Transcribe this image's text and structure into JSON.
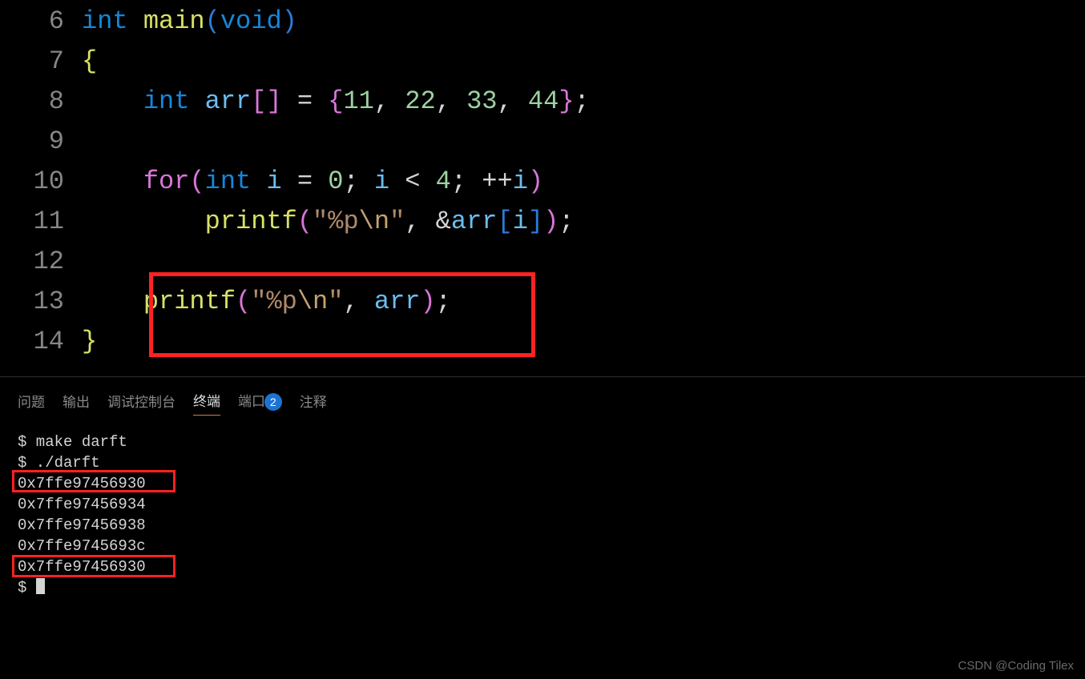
{
  "code": {
    "line6": {
      "n": "6",
      "kw1": "int",
      "fn": "main",
      "lp": "(",
      "kw2": "void",
      "rp": ")"
    },
    "line7": {
      "n": "7",
      "br": "{"
    },
    "line8": {
      "n": "8",
      "kw": "int",
      "var": "arr",
      "lb": "[",
      "rb": "]",
      "eq": " = ",
      "lbr": "{",
      "v1": "11",
      "c1": ", ",
      "v2": "22",
      "c2": ", ",
      "v3": "33",
      "c3": ", ",
      "v4": "44",
      "rbr": "}",
      "semi": ";"
    },
    "line9": {
      "n": "9"
    },
    "line10": {
      "n": "10",
      "kw": "for",
      "lp": "(",
      "kw2": "int",
      "var": "i",
      "eq": " = ",
      "v0": "0",
      "semi1": "; ",
      "var2": "i",
      "lt": " < ",
      "v4": "4",
      "semi2": "; ",
      "inc": "++",
      "var3": "i",
      "rp": ")"
    },
    "line11": {
      "n": "11",
      "fn": "printf",
      "lp": "(",
      "q1": "\"",
      "fmt": "%p",
      "esc": "\\n",
      "q2": "\"",
      "c": ", ",
      "amp": "&",
      "var": "arr",
      "lb": "[",
      "idx": "i",
      "rb": "]",
      "rp": ")",
      "semi": ";"
    },
    "line12": {
      "n": "12"
    },
    "line13": {
      "n": "13",
      "fn": "printf",
      "lp": "(",
      "q1": "\"",
      "fmt": "%p",
      "esc": "\\n",
      "q2": "\"",
      "c": ", ",
      "var": "arr",
      "rp": ")",
      "semi": ";"
    },
    "line14": {
      "n": "14",
      "br": "}"
    }
  },
  "tabs": {
    "problems": "问题",
    "output": "输出",
    "debug": "调试控制台",
    "terminal": "终端",
    "ports": "端口",
    "ports_badge": "2",
    "comments": "注释"
  },
  "terminal": {
    "l1": "$ make darft",
    "l2": "$ ./darft",
    "l3": "0x7ffe97456930",
    "l4": "0x7ffe97456934",
    "l5": "0x7ffe97456938",
    "l6": "0x7ffe9745693c",
    "l7": "0x7ffe97456930",
    "l8": "$ "
  },
  "watermark": "CSDN @Coding Tilex"
}
